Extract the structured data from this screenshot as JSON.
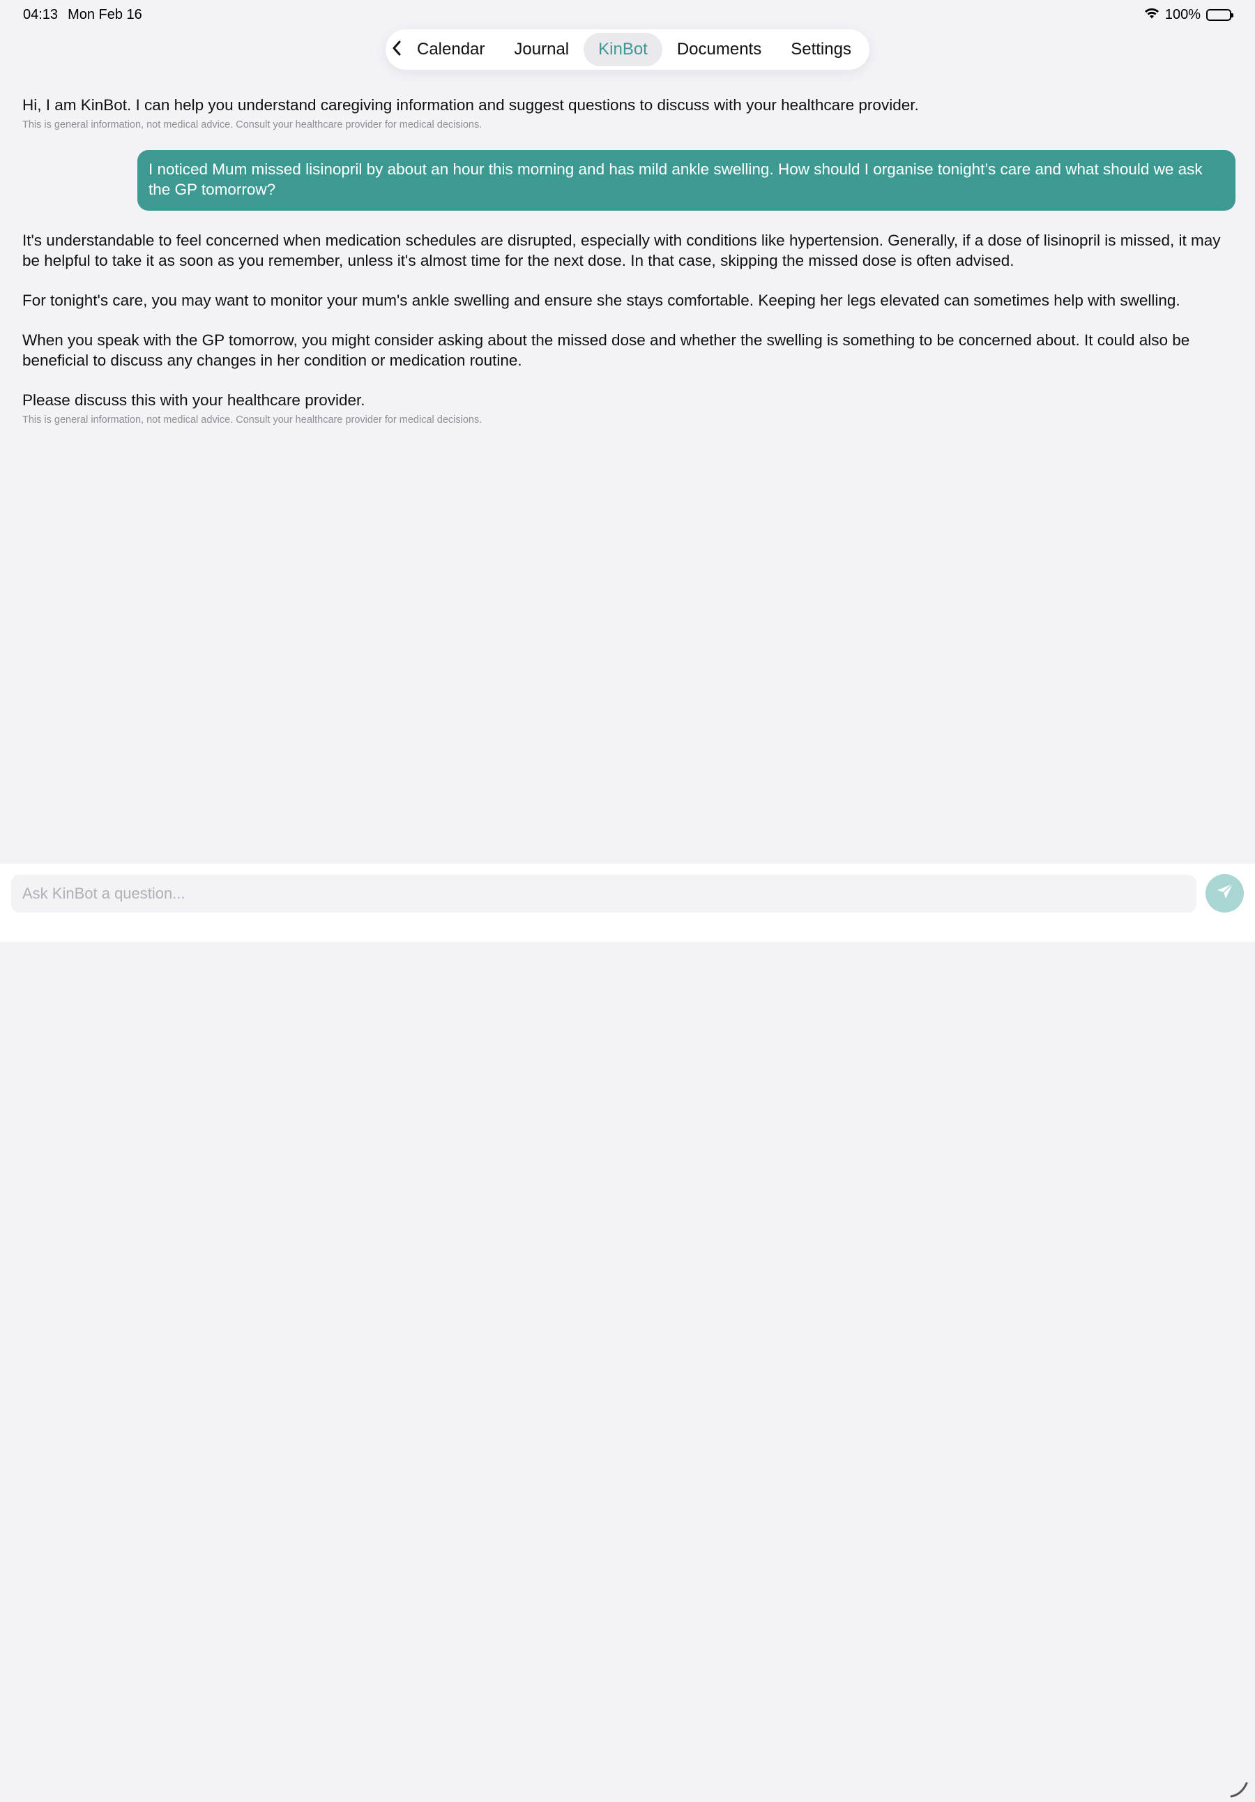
{
  "status_bar": {
    "time": "04:13",
    "date": "Mon Feb 16",
    "battery": "100%",
    "wifi_icon": "wifi-icon",
    "battery_icon": "battery-icon"
  },
  "nav": {
    "back_icon": "chevron-left-icon",
    "tabs": [
      {
        "label": "Calendar",
        "active": false
      },
      {
        "label": "Journal",
        "active": false
      },
      {
        "label": "KinBot",
        "active": true
      },
      {
        "label": "Documents",
        "active": false
      },
      {
        "label": "Settings",
        "active": false
      }
    ]
  },
  "chat": {
    "greeting": "Hi, I am KinBot. I can help you understand caregiving information and suggest questions to discuss with your healthcare provider.",
    "greeting_disclaimer": "This is general information, not medical advice. Consult your healthcare provider for medical decisions.",
    "user_message": "I noticed Mum missed lisinopril by about an hour this morning and has mild ankle swelling. How should I organise tonight’s care and what should we ask the GP tomorrow?",
    "reply": [
      "It's understandable to feel concerned when medication schedules are disrupted, especially with conditions like hypertension. Generally, if a dose of lisinopril is missed, it may be helpful to take it as soon as you remember, unless it's almost time for the next dose. In that case, skipping the missed dose is often advised.",
      "For tonight's care, you may want to monitor your mum's ankle swelling and ensure she stays comfortable. Keeping her legs elevated can sometimes help with swelling.",
      "When you speak with the GP tomorrow, you might consider asking about the missed dose and whether the swelling is something to be concerned about. It could also be beneficial to discuss any changes in her condition or medication routine.",
      "Please discuss this with your healthcare provider."
    ],
    "reply_disclaimer": "This is general information, not medical advice. Consult your healthcare provider for medical decisions."
  },
  "composer": {
    "placeholder": "Ask KinBot a question...",
    "value": "",
    "send_icon": "send-icon"
  },
  "colors": {
    "accent": "#3d9a93",
    "accent_light": "#a9d6d2",
    "background": "#f2f2f7"
  }
}
